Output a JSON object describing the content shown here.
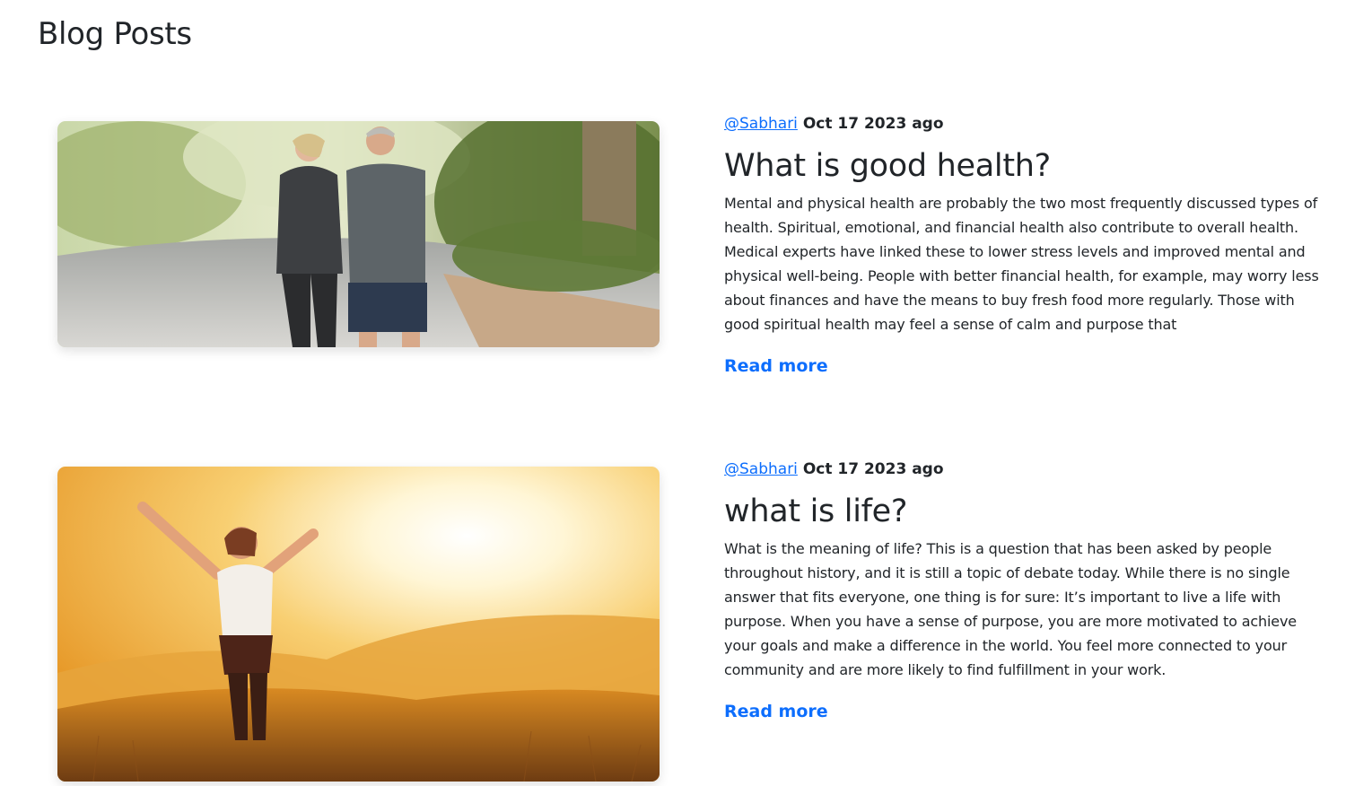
{
  "page": {
    "title": "Blog Posts"
  },
  "posts": [
    {
      "author": "@Sabhari",
      "date": "Oct 17 2023 ago",
      "title": "What is good health?",
      "excerpt_lines": [
        "Mental and physical health are probably the two most frequently discussed types of",
        "health. Spiritual, emotional, and financial health also contribute to overall health.",
        "Medical experts have linked these to lower stress levels and improved mental and",
        "physical well-being. People with better financial health, for example, may worry less",
        "about finances and have the means to buy fresh food more regularly. Those with",
        "good spiritual health may feel a sense of calm and purpose that"
      ],
      "read_more": "Read more",
      "image": "couple-jogging-photo"
    },
    {
      "author": "@Sabhari",
      "date": "Oct 17 2023 ago",
      "title": "what is life?",
      "excerpt_lines": [
        "What is the meaning of life? This is a question that has been asked by people",
        "throughout history, and it is still a topic of debate today. While there is no single",
        "answer that fits everyone, one thing is for sure: It’s important to live a life with",
        "purpose. When you have a sense of purpose, you are more motivated to achieve",
        "your goals and make a difference in the world. You feel more connected to your",
        "community and are more likely to find fulfillment in your work."
      ],
      "read_more": "Read more",
      "image": "woman-sunset-field-photo"
    }
  ],
  "colors": {
    "link": "#0d6efd",
    "text": "#212529",
    "background": "#ffffff"
  }
}
